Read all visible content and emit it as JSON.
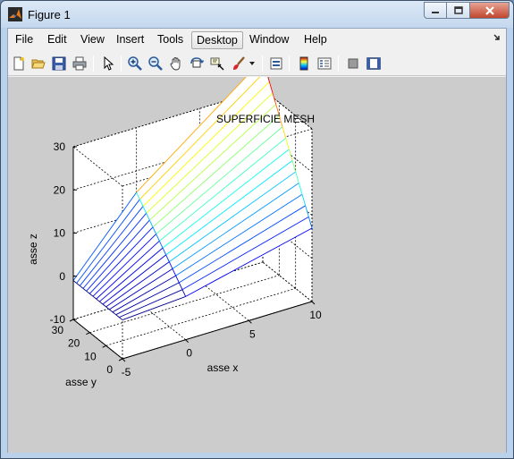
{
  "window": {
    "title": "Figure 1",
    "controls": [
      "minimize",
      "maximize",
      "close"
    ]
  },
  "menubar": {
    "items": [
      {
        "label": "File"
      },
      {
        "label": "Edit"
      },
      {
        "label": "View"
      },
      {
        "label": "Insert"
      },
      {
        "label": "Tools"
      },
      {
        "label": "Desktop",
        "active": true
      },
      {
        "label": "Window"
      },
      {
        "label": "Help"
      }
    ]
  },
  "toolbar": {
    "buttons": [
      "new-figure-icon",
      "open-file-icon",
      "save-icon",
      "print-icon",
      "edit-plot-arrow-icon",
      "zoom-in-icon",
      "zoom-out-icon",
      "pan-hand-icon",
      "rotate-3d-icon",
      "data-cursor-icon",
      "brush-icon",
      "brush-dropdown-icon",
      "link-plot-icon",
      "insert-colorbar-icon",
      "insert-legend-icon",
      "hide-plot-tools-icon",
      "show-plot-tools-icon"
    ]
  },
  "chart_data": {
    "type": "surface",
    "title": "SUPERFICIE MESH",
    "xlabel": "asse x",
    "ylabel": "asse y",
    "zlabel": "asse z",
    "xlim": [
      -5,
      10
    ],
    "ylim": [
      0,
      30
    ],
    "zlim": [
      -10,
      30
    ],
    "xticks": [
      "-5",
      "0",
      "5",
      "10"
    ],
    "yticks": [
      "0",
      "10",
      "20",
      "30"
    ],
    "zticks": [
      "-10",
      "0",
      "10",
      "20",
      "30"
    ],
    "grid": true,
    "colormap": "jet",
    "mesh": {
      "x": [
        -5,
        0,
        10
      ],
      "y": [
        0,
        2,
        4,
        6,
        8,
        10,
        12,
        14,
        16,
        18,
        20,
        22,
        24,
        26,
        28,
        30
      ],
      "z": [
        [
          -1,
          0,
          7
        ],
        [
          -1,
          1,
          9
        ],
        [
          -1,
          2,
          11
        ],
        [
          -1,
          3,
          13
        ],
        [
          -1,
          4,
          15
        ],
        [
          -1,
          5,
          17
        ],
        [
          -1,
          6,
          19
        ],
        [
          -1,
          7,
          21
        ],
        [
          -1,
          8,
          23
        ],
        [
          -1,
          9,
          25
        ],
        [
          -1,
          10,
          27
        ],
        [
          -1,
          11,
          29
        ],
        [
          -1,
          12,
          31
        ],
        [
          -1,
          13,
          33
        ],
        [
          -1,
          14,
          35
        ],
        [
          -1,
          15,
          37
        ]
      ]
    }
  }
}
